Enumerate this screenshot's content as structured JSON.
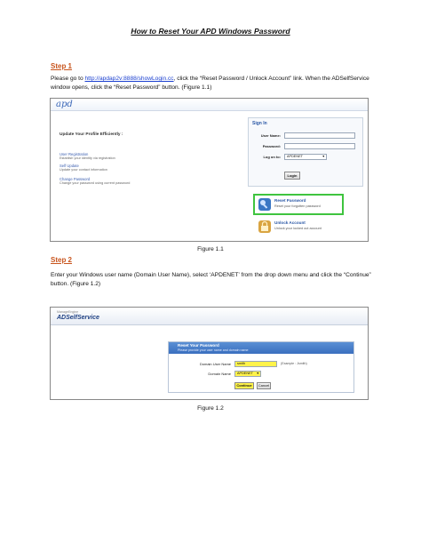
{
  "document": {
    "title": "How to Reset Your APD Windows Password"
  },
  "step1": {
    "heading": "Step 1",
    "text_before_link": "Please go to ",
    "link": "http://apdap2v:8888/showLogin.cc",
    "text_after_link": ", click the “Reset Password / Unlock Account” link. When the ADSelfService window opens, click the “Reset Password” button. (Figure 1.1)",
    "caption": "Figure 1.1"
  },
  "figure1": {
    "logo": "apd",
    "heading": "Update Your Profile Efficiently :",
    "links": [
      {
        "title": "User Registration",
        "desc": "Establish your identity via registration"
      },
      {
        "title": "Self Update",
        "desc": "Update your contact information"
      },
      {
        "title": "Change Password",
        "desc": "Change your password using current password"
      }
    ],
    "signin": {
      "title": "Sign In",
      "username_label": "User Name:",
      "password_label": "Password:",
      "logon_label": "Log on to:",
      "logon_value": "APDENET",
      "login_button": "Login"
    },
    "reset": {
      "title": "Reset Password",
      "desc": "Reset your forgotten password",
      "icon_color": "#3a76c4"
    },
    "unlock": {
      "title": "Unlock Account",
      "desc": "Unlock your locked out account",
      "icon_color": "#d9a441"
    }
  },
  "step2": {
    "heading": "Step 2",
    "text": "Enter your Windows user name (Domain User Name), select ‘APDENET’ from the drop down menu and click the “Continue” button. (Figure 1.2)",
    "caption": "Figure 1.2"
  },
  "figure2": {
    "brand_small": "ManageEngine",
    "brand": "ADSelfService",
    "panel_title": "Reset Your Password",
    "panel_sub": "Please provide your user name and domain name",
    "user_label": "Domain User Name",
    "user_value": "smith",
    "hint": "(Example : Jsmith)",
    "domain_label": "Domain Name",
    "domain_value": "APDENET",
    "continue_button": "Continue",
    "cancel_button": "Cancel",
    "highlight_color": "#fff34a"
  },
  "colors": {
    "step_heading": "#c8551e",
    "link": "#1a3fd0",
    "reset_border": "#3fc43f"
  }
}
